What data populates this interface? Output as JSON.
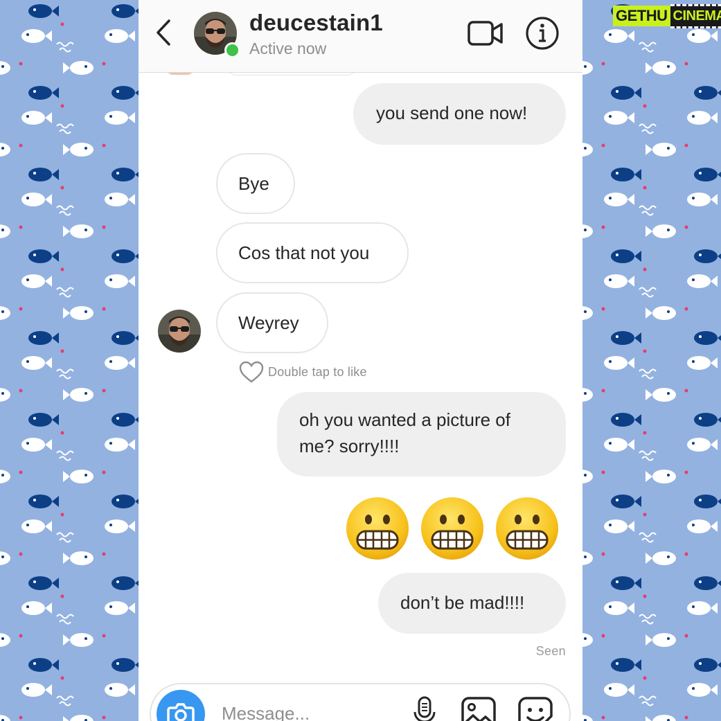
{
  "header": {
    "username": "deucestain1",
    "status": "Active now"
  },
  "messages": [
    {
      "side": "out",
      "text": "you send one now!"
    },
    {
      "side": "in",
      "text": "Bye"
    },
    {
      "side": "in",
      "text": "Cos that not you"
    },
    {
      "side": "in",
      "text": "Weyrey"
    },
    {
      "side": "out",
      "text": "oh you wanted a picture of me? sorry!!!!"
    },
    {
      "side": "out",
      "text": "don’t be mad!!!!"
    }
  ],
  "like_hint": "Double tap to like",
  "seen_label": "Seen",
  "composer": {
    "placeholder": "Message..."
  },
  "watermark": {
    "part1": "GETHU",
    "part2": "CINEMA"
  },
  "emoji_reaction": {
    "icon": "grimacing-face",
    "count": 3
  },
  "colors": {
    "accent": "#3897f0",
    "online": "#3ec24a",
    "background": "#93b2e0"
  }
}
